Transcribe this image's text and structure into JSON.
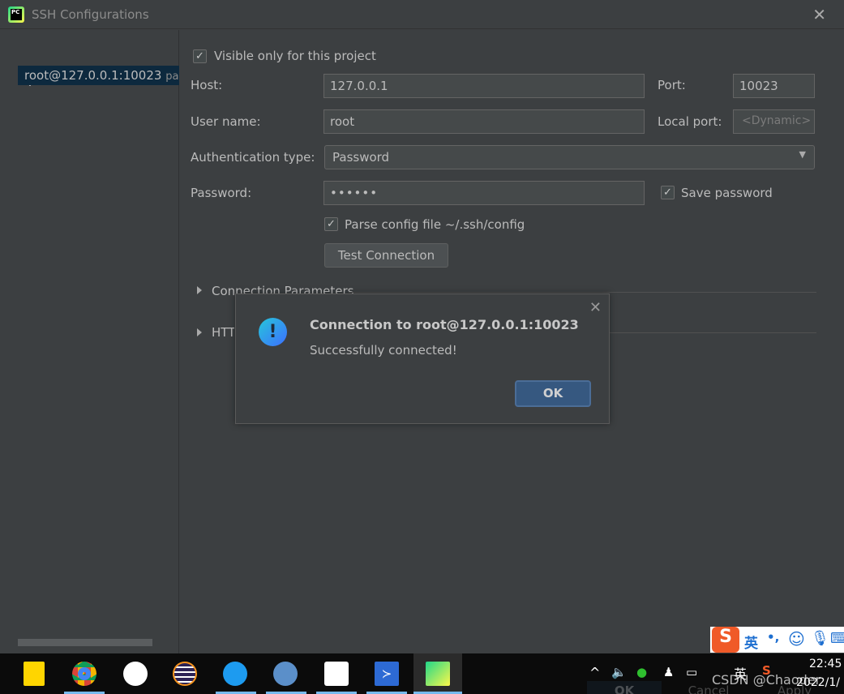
{
  "window": {
    "title": "SSH Configurations",
    "close": "✕"
  },
  "sidebar": {
    "toolbar": {
      "add": "+",
      "remove": "−",
      "copy": "⧉",
      "edit": "✎"
    },
    "items": [
      {
        "label": "root@127.0.0.1:10023",
        "sub": "password"
      }
    ]
  },
  "form": {
    "visible_only": {
      "label": "Visible only for this project",
      "checked": true
    },
    "host": {
      "label": "Host:",
      "value": "127.0.0.1"
    },
    "port": {
      "label": "Port:",
      "value": "10023"
    },
    "user": {
      "label": "User name:",
      "value": "root"
    },
    "local_port": {
      "label": "Local port:",
      "placeholder": "<Dynamic>"
    },
    "auth": {
      "label": "Authentication type:",
      "value": "Password"
    },
    "password": {
      "label": "Password:",
      "value": "••••••"
    },
    "save_password": {
      "label": "Save password",
      "checked": true
    },
    "parse_config": {
      "label": "Parse config file ~/.ssh/config",
      "checked": true
    },
    "test_button": "Test Connection",
    "sections": [
      "Connection Parameters",
      "HTTP/SOCKS Proxy"
    ]
  },
  "dialog": {
    "title": "Connection to root@127.0.0.1:10023",
    "message": "Successfully connected!",
    "ok": "OK",
    "icon": "info-exclamation-icon"
  },
  "taskbar": {
    "clock": "22:45",
    "date": "2022/1/",
    "ime_label": "英",
    "tray_ime": "英",
    "watermark": "CSDN @Chaoder",
    "behind_buttons": [
      "OK",
      "Cancel",
      "Apply"
    ]
  },
  "colors": {
    "bg": "#3c3f41",
    "selection": "#0d293e",
    "ok_button": "#365880",
    "taskbar_indicator": "#76b9ed"
  }
}
